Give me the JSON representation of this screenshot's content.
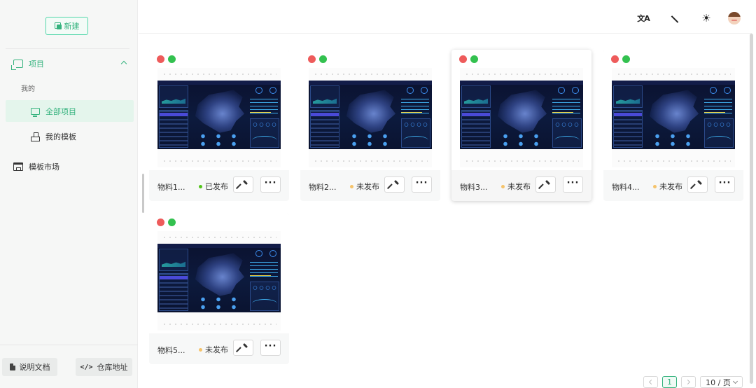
{
  "sidebar": {
    "new_label": "新建",
    "project_label": "项目",
    "group_label": "我的",
    "all_projects_label": "全部项目",
    "my_templates_label": "我的模板",
    "template_market_label": "模板市场",
    "docs_label": "说明文档",
    "repo_label": "仓库地址",
    "accent_color": "#35b37e"
  },
  "header": {
    "icons": [
      "translate-icon",
      "magic-wand-icon",
      "sun-icon",
      "avatar"
    ]
  },
  "cards": [
    {
      "name": "物料1...",
      "status": "已发布",
      "status_color": "#52c41a"
    },
    {
      "name": "物料2...",
      "status": "未发布",
      "status_color": "#f5c36b"
    },
    {
      "name": "物料3...",
      "status": "未发布",
      "status_color": "#f5c36b"
    },
    {
      "name": "物料4...",
      "status": "未发布",
      "status_color": "#f5c36b"
    },
    {
      "name": "物料5...",
      "status": "未发布",
      "status_color": "#f5c36b"
    }
  ],
  "pagination": {
    "current_page": "1",
    "page_size": "10 / 页"
  }
}
